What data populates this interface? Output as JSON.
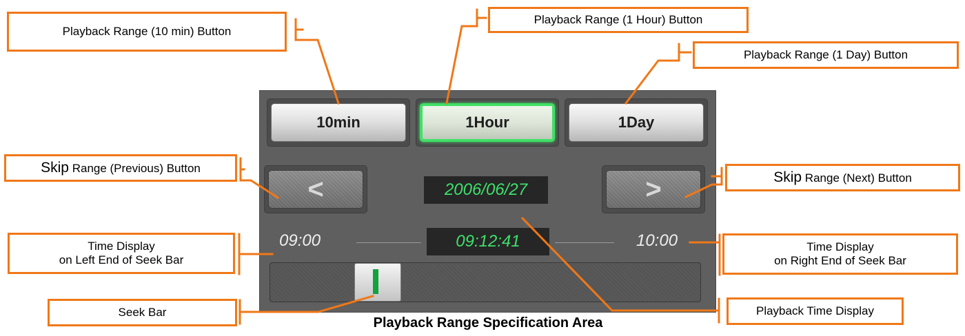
{
  "panel": {
    "range_buttons": {
      "ten_min": "10min",
      "one_hour": "1Hour",
      "one_day": "1Day",
      "selected": "1Hour"
    },
    "skip_prev_glyph": "<",
    "skip_next_glyph": ">",
    "date_display": "2006/06/27",
    "time_left": "09:00",
    "time_current": "09:12:41",
    "time_right": "10:00",
    "seek_position": 0.22,
    "colors": {
      "panel_bg": "#5f5f5f",
      "lcd_text": "#3ee06a",
      "active_glow": "#3fe066",
      "seek_mark": "#11a33d"
    }
  },
  "callouts": {
    "range_10min": "Playback Range (10 min) Button",
    "range_1hour": "Playback Range (1 Hour) Button",
    "range_1day": "Playback Range (1 Day) Button",
    "skip_prev_big": "Skip",
    "skip_prev_rest": " Range (Previous) Button",
    "skip_next_big": "Skip",
    "skip_next_rest": " Range (Next) Button",
    "time_left_line1": "Time Display",
    "time_left_line2": "on Left End of Seek Bar",
    "time_right_line1": "Time Display",
    "time_right_line2": "on Right End of Seek Bar",
    "seek_bar": "Seek Bar",
    "playback_time": "Playback Time Display",
    "accent_color": "#f07818"
  },
  "caption": "Playback Range Specification Area"
}
